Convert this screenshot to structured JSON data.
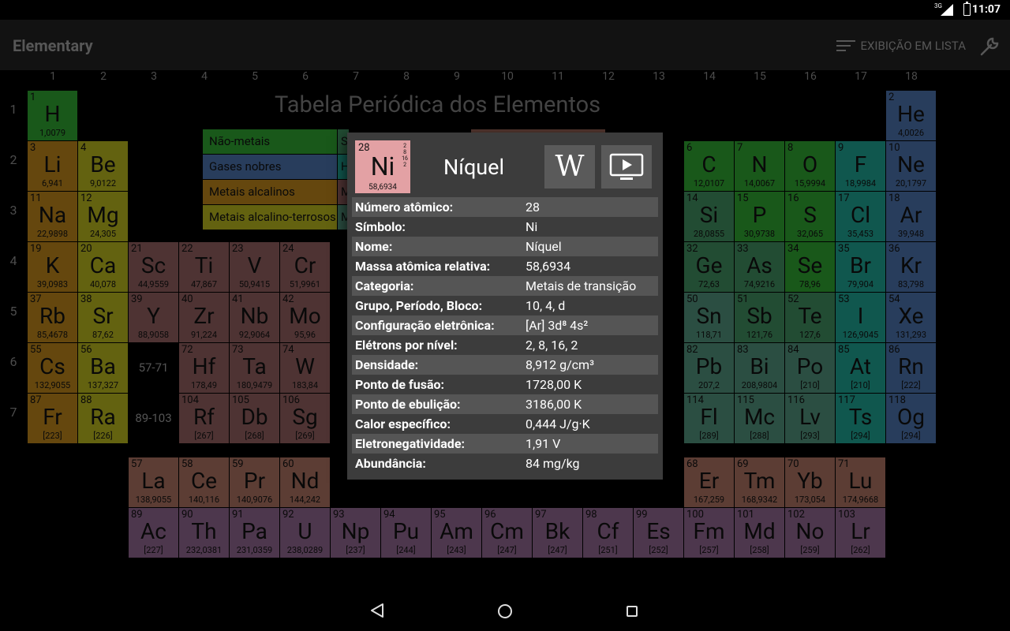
{
  "status": {
    "time": "11:07",
    "network": "3G"
  },
  "appbar": {
    "title": "Elementary",
    "list_view_label": "EXIBIÇÃO EM LISTA"
  },
  "board": {
    "title": "Tabela Periódica dos Elementos",
    "groups": [
      "1",
      "2",
      "3",
      "4",
      "5",
      "6",
      "7",
      "8",
      "9",
      "10",
      "11",
      "12",
      "13",
      "14",
      "15",
      "16",
      "17",
      "18"
    ],
    "periods": [
      "1",
      "2",
      "3",
      "4",
      "5",
      "6",
      "7"
    ],
    "placeholders": [
      "57-71",
      "89-103"
    ]
  },
  "legend": {
    "items": [
      "Não-metais",
      "Gases nobres",
      "Metais alcalinos",
      "Metais alcalino-terrosos",
      "S",
      "H",
      "M",
      "M"
    ]
  },
  "colors": {
    "nonmetal": "#2ea031",
    "noble": "#4a6fa8",
    "alkali": "#b8811a",
    "alkearth": "#b4b21e",
    "transition": "#8f5e5e",
    "lanthanide": "#a86f5f",
    "actinide": "#8d648d",
    "selected": "#e3a1a4"
  },
  "elements": [
    {
      "n": "1",
      "s": "H",
      "m": "1,0079",
      "g": 1,
      "p": 1,
      "c": "nonmetal"
    },
    {
      "n": "2",
      "s": "He",
      "m": "4,0026",
      "g": 18,
      "p": 1,
      "c": "noble"
    },
    {
      "n": "3",
      "s": "Li",
      "m": "6,941",
      "g": 1,
      "p": 2,
      "c": "alkali"
    },
    {
      "n": "4",
      "s": "Be",
      "m": "9,0122",
      "g": 2,
      "p": 2,
      "c": "alkearth"
    },
    {
      "n": "6",
      "s": "C",
      "m": "12,0107",
      "g": 14,
      "p": 2,
      "c": "nonmetal"
    },
    {
      "n": "7",
      "s": "N",
      "m": "14,0067",
      "g": 15,
      "p": 2,
      "c": "nonmetal"
    },
    {
      "n": "8",
      "s": "O",
      "m": "15,9994",
      "g": 16,
      "p": 2,
      "c": "nonmetal"
    },
    {
      "n": "9",
      "s": "F",
      "m": "18,9984",
      "g": 17,
      "p": 2,
      "c": "halogen"
    },
    {
      "n": "10",
      "s": "Ne",
      "m": "20,1797",
      "g": 18,
      "p": 2,
      "c": "noble"
    },
    {
      "n": "11",
      "s": "Na",
      "m": "22,9898",
      "g": 1,
      "p": 3,
      "c": "alkali"
    },
    {
      "n": "12",
      "s": "Mg",
      "m": "24,305",
      "g": 2,
      "p": 3,
      "c": "alkearth"
    },
    {
      "n": "14",
      "s": "Si",
      "m": "28,0855",
      "g": 14,
      "p": 3,
      "c": "metalloid"
    },
    {
      "n": "15",
      "s": "P",
      "m": "30,9738",
      "g": 15,
      "p": 3,
      "c": "nonmetal"
    },
    {
      "n": "16",
      "s": "S",
      "m": "32,065",
      "g": 16,
      "p": 3,
      "c": "nonmetal"
    },
    {
      "n": "17",
      "s": "Cl",
      "m": "35,453",
      "g": 17,
      "p": 3,
      "c": "halogen"
    },
    {
      "n": "18",
      "s": "Ar",
      "m": "39,948",
      "g": 18,
      "p": 3,
      "c": "noble"
    },
    {
      "n": "19",
      "s": "K",
      "m": "39,0983",
      "g": 1,
      "p": 4,
      "c": "alkali"
    },
    {
      "n": "20",
      "s": "Ca",
      "m": "40,078",
      "g": 2,
      "p": 4,
      "c": "alkearth"
    },
    {
      "n": "21",
      "s": "Sc",
      "m": "44,9559",
      "g": 3,
      "p": 4,
      "c": "transition"
    },
    {
      "n": "22",
      "s": "Ti",
      "m": "47,867",
      "g": 4,
      "p": 4,
      "c": "transition"
    },
    {
      "n": "23",
      "s": "V",
      "m": "50,9415",
      "g": 5,
      "p": 4,
      "c": "transition"
    },
    {
      "n": "24",
      "s": "Cr",
      "m": "51,9961",
      "g": 6,
      "p": 4,
      "c": "transition"
    },
    {
      "n": "32",
      "s": "Ge",
      "m": "72,63",
      "g": 14,
      "p": 4,
      "c": "metalloid"
    },
    {
      "n": "33",
      "s": "As",
      "m": "74,9216",
      "g": 15,
      "p": 4,
      "c": "metalloid"
    },
    {
      "n": "34",
      "s": "Se",
      "m": "78,96",
      "g": 16,
      "p": 4,
      "c": "nonmetal"
    },
    {
      "n": "35",
      "s": "Br",
      "m": "79,904",
      "g": 17,
      "p": 4,
      "c": "halogen"
    },
    {
      "n": "36",
      "s": "Kr",
      "m": "83,798",
      "g": 18,
      "p": 4,
      "c": "noble"
    },
    {
      "n": "37",
      "s": "Rb",
      "m": "85,4678",
      "g": 1,
      "p": 5,
      "c": "alkali"
    },
    {
      "n": "38",
      "s": "Sr",
      "m": "87,62",
      "g": 2,
      "p": 5,
      "c": "alkearth"
    },
    {
      "n": "39",
      "s": "Y",
      "m": "88,9058",
      "g": 3,
      "p": 5,
      "c": "transition"
    },
    {
      "n": "40",
      "s": "Zr",
      "m": "91,224",
      "g": 4,
      "p": 5,
      "c": "transition"
    },
    {
      "n": "41",
      "s": "Nb",
      "m": "92,9064",
      "g": 5,
      "p": 5,
      "c": "transition"
    },
    {
      "n": "42",
      "s": "Mo",
      "m": "95,96",
      "g": 6,
      "p": 5,
      "c": "transition"
    },
    {
      "n": "50",
      "s": "Sn",
      "m": "118,71",
      "g": 14,
      "p": 5,
      "c": "post"
    },
    {
      "n": "51",
      "s": "Sb",
      "m": "121,76",
      "g": 15,
      "p": 5,
      "c": "metalloid"
    },
    {
      "n": "52",
      "s": "Te",
      "m": "127,6",
      "g": 16,
      "p": 5,
      "c": "metalloid"
    },
    {
      "n": "53",
      "s": "I",
      "m": "126,9045",
      "g": 17,
      "p": 5,
      "c": "halogen"
    },
    {
      "n": "54",
      "s": "Xe",
      "m": "131,293",
      "g": 18,
      "p": 5,
      "c": "noble"
    },
    {
      "n": "55",
      "s": "Cs",
      "m": "132,9055",
      "g": 1,
      "p": 6,
      "c": "alkali"
    },
    {
      "n": "56",
      "s": "Ba",
      "m": "137,327",
      "g": 2,
      "p": 6,
      "c": "alkearth"
    },
    {
      "n": "72",
      "s": "Hf",
      "m": "178,49",
      "g": 4,
      "p": 6,
      "c": "transition"
    },
    {
      "n": "73",
      "s": "Ta",
      "m": "180,9479",
      "g": 5,
      "p": 6,
      "c": "transition"
    },
    {
      "n": "74",
      "s": "W",
      "m": "183,84",
      "g": 6,
      "p": 6,
      "c": "transition"
    },
    {
      "n": "82",
      "s": "Pb",
      "m": "207,2",
      "g": 14,
      "p": 6,
      "c": "post"
    },
    {
      "n": "83",
      "s": "Bi",
      "m": "208,9804",
      "g": 15,
      "p": 6,
      "c": "post"
    },
    {
      "n": "84",
      "s": "Po",
      "m": "[210]",
      "g": 16,
      "p": 6,
      "c": "post"
    },
    {
      "n": "85",
      "s": "At",
      "m": "[210]",
      "g": 17,
      "p": 6,
      "c": "halogen"
    },
    {
      "n": "86",
      "s": "Rn",
      "m": "[222]",
      "g": 18,
      "p": 6,
      "c": "noble"
    },
    {
      "n": "87",
      "s": "Fr",
      "m": "[223]",
      "g": 1,
      "p": 7,
      "c": "alkali"
    },
    {
      "n": "88",
      "s": "Ra",
      "m": "[226]",
      "g": 2,
      "p": 7,
      "c": "alkearth"
    },
    {
      "n": "104",
      "s": "Rf",
      "m": "[267]",
      "g": 4,
      "p": 7,
      "c": "transition"
    },
    {
      "n": "105",
      "s": "Db",
      "m": "[268]",
      "g": 5,
      "p": 7,
      "c": "transition"
    },
    {
      "n": "106",
      "s": "Sg",
      "m": "[269]",
      "g": 6,
      "p": 7,
      "c": "transition"
    },
    {
      "n": "114",
      "s": "Fl",
      "m": "[289]",
      "g": 14,
      "p": 7,
      "c": "post"
    },
    {
      "n": "115",
      "s": "Mc",
      "m": "[288]",
      "g": 15,
      "p": 7,
      "c": "post"
    },
    {
      "n": "116",
      "s": "Lv",
      "m": "[293]",
      "g": 16,
      "p": 7,
      "c": "post"
    },
    {
      "n": "117",
      "s": "Ts",
      "m": "[294]",
      "g": 17,
      "p": 7,
      "c": "halogen"
    },
    {
      "n": "118",
      "s": "Og",
      "m": "[294]",
      "g": 18,
      "p": 7,
      "c": "noble"
    },
    {
      "n": "57",
      "s": "La",
      "m": "138,9055",
      "g": 3,
      "p": 9,
      "c": "lanth"
    },
    {
      "n": "58",
      "s": "Ce",
      "m": "140,116",
      "g": 4,
      "p": 9,
      "c": "lanth"
    },
    {
      "n": "59",
      "s": "Pr",
      "m": "140,9076",
      "g": 5,
      "p": 9,
      "c": "lanth"
    },
    {
      "n": "60",
      "s": "Nd",
      "m": "144,242",
      "g": 6,
      "p": 9,
      "c": "lanth"
    },
    {
      "n": "68",
      "s": "Er",
      "m": "167,259",
      "g": 14,
      "p": 9,
      "c": "lanth"
    },
    {
      "n": "69",
      "s": "Tm",
      "m": "168,9342",
      "g": 15,
      "p": 9,
      "c": "lanth"
    },
    {
      "n": "70",
      "s": "Yb",
      "m": "173,054",
      "g": 16,
      "p": 9,
      "c": "lanth"
    },
    {
      "n": "71",
      "s": "Lu",
      "m": "174,9668",
      "g": 17,
      "p": 9,
      "c": "lanth"
    },
    {
      "n": "89",
      "s": "Ac",
      "m": "[227]",
      "g": 3,
      "p": 10,
      "c": "act"
    },
    {
      "n": "90",
      "s": "Th",
      "m": "232,0381",
      "g": 4,
      "p": 10,
      "c": "act"
    },
    {
      "n": "91",
      "s": "Pa",
      "m": "231,0359",
      "g": 5,
      "p": 10,
      "c": "act"
    },
    {
      "n": "92",
      "s": "U",
      "m": "238,0289",
      "g": 6,
      "p": 10,
      "c": "act"
    },
    {
      "n": "93",
      "s": "Np",
      "m": "[237]",
      "g": 7,
      "p": 10,
      "c": "act"
    },
    {
      "n": "94",
      "s": "Pu",
      "m": "[244]",
      "g": 8,
      "p": 10,
      "c": "act"
    },
    {
      "n": "95",
      "s": "Am",
      "m": "[243]",
      "g": 9,
      "p": 10,
      "c": "act"
    },
    {
      "n": "96",
      "s": "Cm",
      "m": "[247]",
      "g": 10,
      "p": 10,
      "c": "act"
    },
    {
      "n": "97",
      "s": "Bk",
      "m": "[247]",
      "g": 11,
      "p": 10,
      "c": "act"
    },
    {
      "n": "98",
      "s": "Cf",
      "m": "[251]",
      "g": 12,
      "p": 10,
      "c": "act"
    },
    {
      "n": "99",
      "s": "Es",
      "m": "[252]",
      "g": 13,
      "p": 10,
      "c": "act"
    },
    {
      "n": "100",
      "s": "Fm",
      "m": "[257]",
      "g": 14,
      "p": 10,
      "c": "act"
    },
    {
      "n": "101",
      "s": "Md",
      "m": "[258]",
      "g": 15,
      "p": 10,
      "c": "act"
    },
    {
      "n": "102",
      "s": "No",
      "m": "[259]",
      "g": 16,
      "p": 10,
      "c": "act"
    },
    {
      "n": "103",
      "s": "Lr",
      "m": "[262]",
      "g": 17,
      "p": 10,
      "c": "act"
    }
  ],
  "dialog": {
    "tile": {
      "number": "28",
      "symbol": "Ni",
      "mass": "58,6934",
      "shells": [
        "2",
        "8",
        "16",
        "2"
      ]
    },
    "name": "Níquel",
    "wiki_label": "W",
    "properties": [
      {
        "label": "Número atômico:",
        "value": "28"
      },
      {
        "label": "Símbolo:",
        "value": "Ni"
      },
      {
        "label": "Nome:",
        "value": "Níquel"
      },
      {
        "label": "Massa atômica relativa:",
        "value": "58,6934"
      },
      {
        "label": "Categoria:",
        "value": "Metais de transição"
      },
      {
        "label": "Grupo, Período, Bloco:",
        "value": "10, 4, d"
      },
      {
        "label": "Configuração eletrônica:",
        "value": "[Ar] 3d⁸ 4s²"
      },
      {
        "label": "Elétrons por nível:",
        "value": "2, 8, 16, 2"
      },
      {
        "label": "Densidade:",
        "value": "8,912 g/cm³"
      },
      {
        "label": "Ponto de fusão:",
        "value": "1728,00 K"
      },
      {
        "label": "Ponto de ebulição:",
        "value": "3186,00 K"
      },
      {
        "label": "Calor específico:",
        "value": "0,444 J/g·K"
      },
      {
        "label": "Eletronegatividade:",
        "value": "1,91 V"
      },
      {
        "label": "Abundância:",
        "value": "84 mg/kg"
      }
    ]
  }
}
